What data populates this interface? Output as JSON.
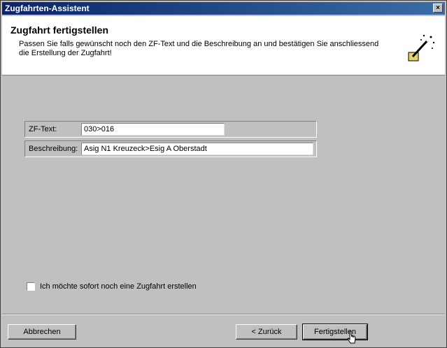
{
  "window": {
    "title": "Zugfahrten-Assistent",
    "close_glyph": "×"
  },
  "header": {
    "title": "Zugfahrt fertigstellen",
    "description": "Passen Sie falls gewünscht noch den ZF-Text und die Beschreibung an und bestätigen Sie anschliessend die Erstellung der Zugfahrt!",
    "icon": "magic-wand-icon"
  },
  "form": {
    "zf_text": {
      "label": "ZF-Text:",
      "value": "030>016"
    },
    "beschreibung": {
      "label": "Beschreibung:",
      "value": "Asig N1 Kreuzeck>Esig A Oberstadt"
    }
  },
  "checkbox": {
    "label": "Ich möchte sofort noch eine Zugfahrt erstellen",
    "checked": false
  },
  "buttons": {
    "cancel": "Abbrechen",
    "back": "< Zurück",
    "finish": "Fertigstellen"
  }
}
